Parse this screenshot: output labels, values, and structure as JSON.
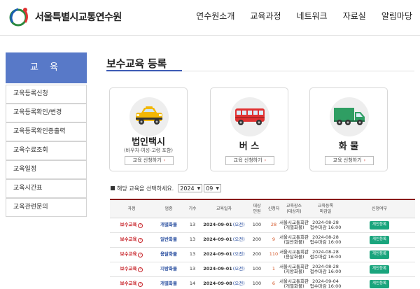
{
  "header": {
    "logo_text": "서울특별시교통연수원",
    "nav": [
      "연수원소개",
      "교육과정",
      "네트워크",
      "자료실",
      "알림마당"
    ]
  },
  "sidebar": {
    "title": "교 육",
    "items": [
      "교육등록신청",
      "교육등록확인/변경",
      "교육등록확인증출력",
      "교육수료조회",
      "교육일정",
      "교육시간표",
      "교육관련문의"
    ]
  },
  "main": {
    "title": "보수교육 등록",
    "cards": [
      {
        "name": "법인택시",
        "sub": "(바우처·여성·고령 포함)",
        "button": "교육 신청하기",
        "icon": "taxi-icon"
      },
      {
        "name": "버 스",
        "sub": "",
        "button": "교육 신청하기",
        "icon": "bus-icon"
      },
      {
        "name": "화 물",
        "sub": "",
        "button": "교육 신청하기",
        "icon": "truck-icon"
      }
    ],
    "select_label": "해당 교육을 선택하세요.",
    "year": "2024",
    "month": "09",
    "table": {
      "headers": [
        "과정",
        "업종",
        "기수",
        "교육일자",
        "대상\n인원",
        "신청자",
        "교육장소\n(대상자)",
        "교육등록\n마감일",
        "신청여부"
      ],
      "rows": [
        {
          "course": "보수교육",
          "work": "개별화물",
          "term": "13",
          "date": "2024-09-01",
          "ampm": "(오전)",
          "capacity": "100",
          "applied": "28",
          "place": "서울시교통회관",
          "target": "(개별화물)",
          "deadline_date": "2024-08-28",
          "deadline_time": "접수마감 16:00",
          "action": "개인등록"
        },
        {
          "course": "보수교육",
          "work": "일반화물",
          "term": "13",
          "date": "2024-09-01",
          "ampm": "(오전)",
          "capacity": "200",
          "applied": "9",
          "place": "서울시교통회관",
          "target": "(일반화물)",
          "deadline_date": "2024-08-28",
          "deadline_time": "접수마감 16:00",
          "action": "개인등록"
        },
        {
          "course": "보수교육",
          "work": "용달화물",
          "term": "13",
          "date": "2024-09-01",
          "ampm": "(오전)",
          "capacity": "200",
          "applied": "110",
          "place": "서울시교통회관",
          "target": "(용달화물)",
          "deadline_date": "2024-08-28",
          "deadline_time": "접수마감 16:00",
          "action": "개인등록"
        },
        {
          "course": "보수교육",
          "work": "지방화물",
          "term": "13",
          "date": "2024-09-01",
          "ampm": "(오전)",
          "capacity": "100",
          "applied": "1",
          "place": "서울시교통회관",
          "target": "(지방화물)",
          "deadline_date": "2024-08-28",
          "deadline_time": "접수마감 16:00",
          "action": "개인등록"
        },
        {
          "course": "보수교육",
          "work": "개별화물",
          "term": "14",
          "date": "2024-09-08",
          "ampm": "(오전)",
          "capacity": "100",
          "applied": "6",
          "place": "서울시교통회관",
          "target": "(개별화물)",
          "deadline_date": "2024-09-04",
          "deadline_time": "접수마감 16:00",
          "action": "개인등록"
        }
      ]
    }
  },
  "colors": {
    "sidebar_title_bg": "#5879c8",
    "title_underline": "#3d5bb5",
    "table_top_border": "#8a1c1c",
    "course_red": "#c8262c",
    "work_blue": "#2a4fa0",
    "register_green": "#1aa57d",
    "applied_orange": "#d4582a"
  }
}
